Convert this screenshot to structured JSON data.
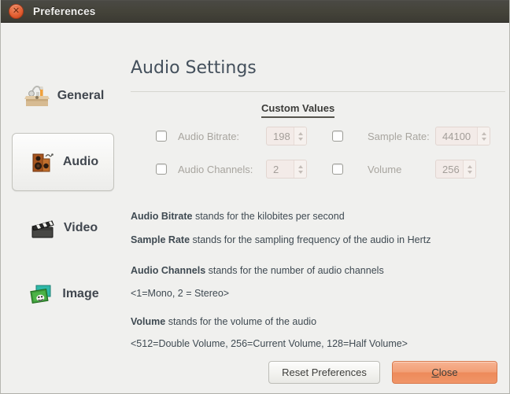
{
  "window": {
    "title": "Preferences",
    "close_icon": "window-close-icon"
  },
  "sidebar": {
    "items": [
      {
        "label": "General",
        "icon": "toolbox-icon",
        "selected": false
      },
      {
        "label": "Audio",
        "icon": "speaker-icon",
        "selected": true
      },
      {
        "label": "Video",
        "icon": "clapperboard-icon",
        "selected": false
      },
      {
        "label": "Image",
        "icon": "photos-icon",
        "selected": false
      }
    ]
  },
  "main": {
    "page_title": "Audio Settings",
    "section_heading": "Custom Values",
    "fields": [
      {
        "label": "Audio Bitrate:",
        "value": "198",
        "checked": false,
        "enabled": false
      },
      {
        "label": "Sample Rate:",
        "value": "44100",
        "checked": false,
        "enabled": false
      },
      {
        "label": "Audio Channels:",
        "value": "2",
        "checked": false,
        "enabled": false
      },
      {
        "label": "Volume",
        "value": "256",
        "checked": false,
        "enabled": false
      }
    ],
    "descriptions": [
      {
        "term": "Audio Bitrate",
        "text": " stands for the kilobites per second"
      },
      {
        "term": "Sample Rate",
        "text": " stands for the sampling frequency of the audio in Hertz"
      },
      {
        "term": "Audio Channels",
        "text": " stands for the number of audio channels"
      },
      {
        "term": "",
        "text": "<1=Mono, 2 = Stereo>"
      },
      {
        "term": "Volume",
        "text": " stands for the volume of the audio"
      },
      {
        "term": "",
        "text": "<512=Double Volume, 256=Current Volume, 128=Half Volume>"
      }
    ]
  },
  "footer": {
    "reset_label": "Reset Preferences",
    "close_mnemonic": "C",
    "close_rest": "lose"
  },
  "colors": {
    "titlebar": "#444339",
    "accent_orange": "#ef8c5e",
    "window_bg": "#f0f0ee",
    "heading_text": "#44505c",
    "disabled_text": "#a8a59f",
    "spinner_bg": "#f3ebe8"
  }
}
